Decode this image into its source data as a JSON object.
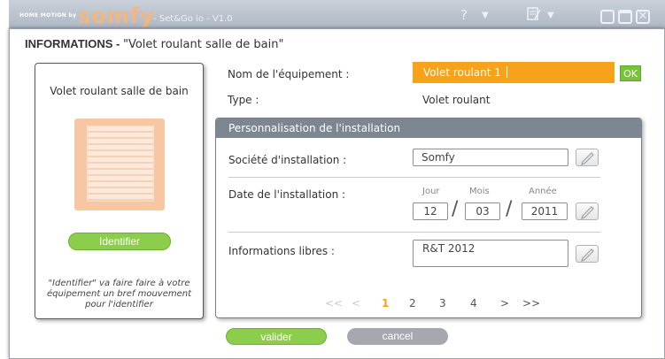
{
  "titlebar": {
    "brand_small": "HOME MOTION by",
    "brand_logo": "somfy",
    "app_name": "- Set&Go io - V1.0",
    "help_icon": "?",
    "menu_icon": "notepad-icon"
  },
  "dialog": {
    "title_prefix": "INFORMATIONS - ",
    "title_name": "\"Volet roulant salle de bain\""
  },
  "device_panel": {
    "name": "Volet roulant salle de bain",
    "identify_button": "Identifier",
    "hint": "\"Identifier\" va faire faire à votre équipement un bref mouvement pour l'identifier"
  },
  "equipment": {
    "name_label": "Nom de l'équipement :",
    "name_value": "Volet roulant 1",
    "ok_button": "OK",
    "type_label": "Type :",
    "type_value": "Volet roulant"
  },
  "installation": {
    "header": "Personnalisation de l'installation",
    "company_label": "Société d'installation :",
    "company_value": "Somfy",
    "date_label": "Date de l'installation :",
    "day_label": "Jour",
    "month_label": "Mois",
    "year_label": "Année",
    "day_value": "12",
    "month_value": "03",
    "year_value": "2011",
    "separator": "/",
    "free_info_label": "Informations libres :",
    "free_info_value": "R&T 2012"
  },
  "pagination": {
    "first": "<<",
    "prev": "<",
    "pages": [
      "1",
      "2",
      "3",
      "4"
    ],
    "current_page": "1",
    "next": ">",
    "last": ">>"
  },
  "actions": {
    "validate": "valider",
    "cancel": "cancel"
  },
  "colors": {
    "accent_orange": "#f6a21a",
    "button_green": "#8ccd4b",
    "button_gray": "#a5a9af",
    "section_header": "#7d8791"
  }
}
